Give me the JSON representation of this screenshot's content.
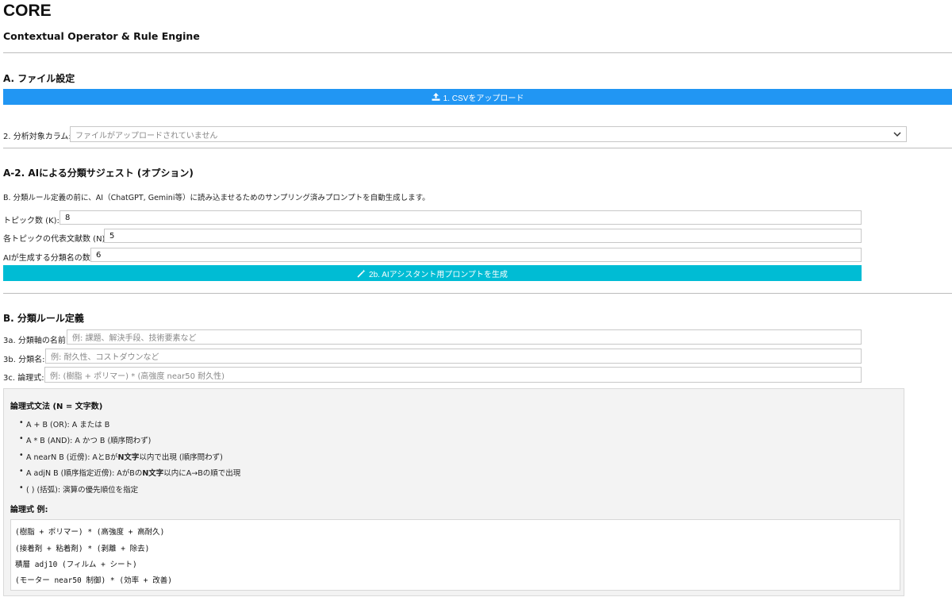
{
  "app": {
    "title": "CORE",
    "subtitle": "Contextual Operator & Rule Engine"
  },
  "section_a": {
    "heading": "A. ファイル設定",
    "upload_button": {
      "label": "1. CSVをアップロード",
      "icon": "upload-icon"
    },
    "column_label": "2. 分析対象カラム:",
    "column_select_value": "ファイルがアップロードされていません"
  },
  "section_a2": {
    "heading": "A-2. AIによる分類サジェスト (オプション)",
    "description": "B. 分類ルール定義の前に、AI（ChatGPT, Gemini等）に読み込ませるためのサンプリング済みプロンプトを自動生成します。",
    "topic_count_label": "トピック数 (K):",
    "topic_count_value": "8",
    "docs_per_topic_label": "各トピックの代表文献数 (N):",
    "docs_per_topic_value": "5",
    "class_name_count_label": "AIが生成する分類名の数:",
    "class_name_count_value": "6",
    "generate_button": {
      "label": "2b. AIアシスタント用プロンプトを生成",
      "icon": "magic-wand-icon"
    }
  },
  "section_b": {
    "heading": "B. 分類ルール定義",
    "axis_name_label": "3a. 分類軸の名前:",
    "axis_name_placeholder": "例: 課題、解決手段、技術要素など",
    "class_name_label": "3b. 分類名:",
    "class_name_placeholder": "例: 耐久性、コストダウンなど",
    "expression_label": "3c. 論理式:",
    "expression_placeholder": "例: (樹脂 + ポリマー) * (高強度 near50 耐久性)"
  },
  "syntax": {
    "title": "論理式文法 (N = 文字数)",
    "items": [
      {
        "code": "A + B",
        "text": " (OR): A または B"
      },
      {
        "code": "A * B",
        "text": " (AND): A かつ B (順序問わず)"
      },
      {
        "code": "A nearN B",
        "text": " (近傍): AとBが",
        "bold": "N文字",
        "tail": "以内で出現 (順序問わず)"
      },
      {
        "code": "A adjN B",
        "text": " (順序指定近傍): AがBの",
        "bold": "N文字",
        "tail": "以内にA→Bの順で出現"
      },
      {
        "code": "( )",
        "text": " (括弧): 演算の優先順位を指定"
      }
    ],
    "examples_title": "論理式 例:",
    "examples": [
      "(樹脂 + ポリマー) * (高強度 + 高耐久)",
      "(接着剤 + 粘着剤) * (剥離 + 除去)",
      "積層 adj10 (フィルム + シート)",
      "(モーター near50 制御) * (効率 + 改善)"
    ]
  },
  "colors": {
    "primary_button": "#2196f3",
    "accent_button": "#00bcd4",
    "panel_background": "#f3f3f3"
  }
}
